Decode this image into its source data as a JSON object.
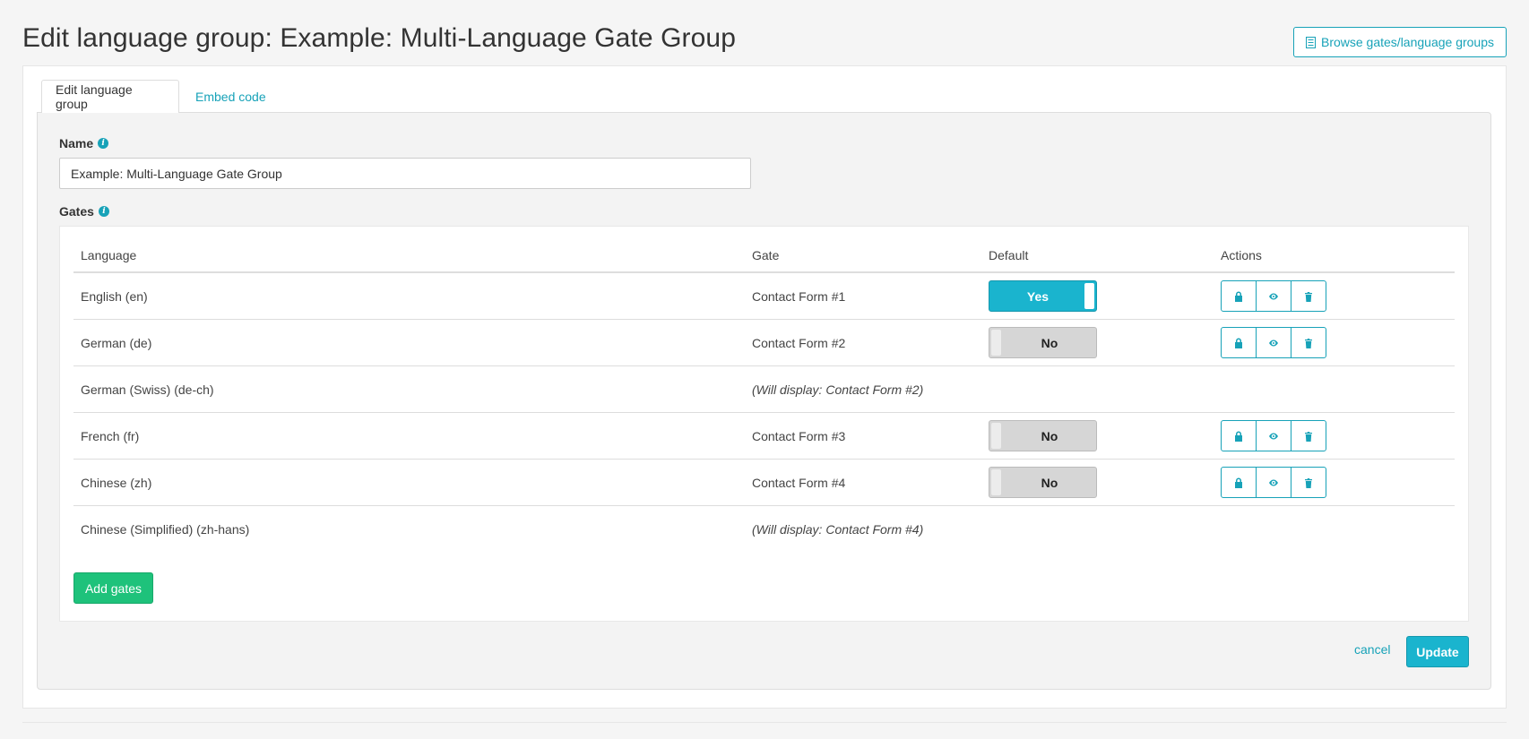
{
  "page": {
    "title": "Edit language group: Example: Multi-Language Gate Group",
    "browse_button": "Browse gates/language groups"
  },
  "tabs": [
    {
      "label": "Edit language group",
      "active": true
    },
    {
      "label": "Embed code",
      "active": false
    }
  ],
  "form": {
    "name_label": "Name",
    "name_value": "Example: Multi-Language Gate Group",
    "gates_label": "Gates"
  },
  "table": {
    "headers": {
      "language": "Language",
      "gate": "Gate",
      "default": "Default",
      "actions": "Actions"
    },
    "rows": [
      {
        "language": "English (en)",
        "gate": "Contact Form #1",
        "inherited": false,
        "default": "Yes"
      },
      {
        "language": "German (de)",
        "gate": "Contact Form #2",
        "inherited": false,
        "default": "No"
      },
      {
        "language": "German (Swiss) (de-ch)",
        "gate": "(Will display: Contact Form #2)",
        "inherited": true
      },
      {
        "language": "French (fr)",
        "gate": "Contact Form #3",
        "inherited": false,
        "default": "No"
      },
      {
        "language": "Chinese (zh)",
        "gate": "Contact Form #4",
        "inherited": false,
        "default": "No"
      },
      {
        "language": "Chinese (Simplified) (zh-hans)",
        "gate": "(Will display: Contact Form #4)",
        "inherited": true
      }
    ],
    "action_icons": [
      "lock-icon",
      "eye-icon",
      "trash-icon"
    ]
  },
  "buttons": {
    "add_gates": "Add gates",
    "cancel": "cancel",
    "update": "Update"
  },
  "colors": {
    "accent": "#17a2b8",
    "toggle_on": "#1ab4ce",
    "add_green": "#1ec27b"
  }
}
